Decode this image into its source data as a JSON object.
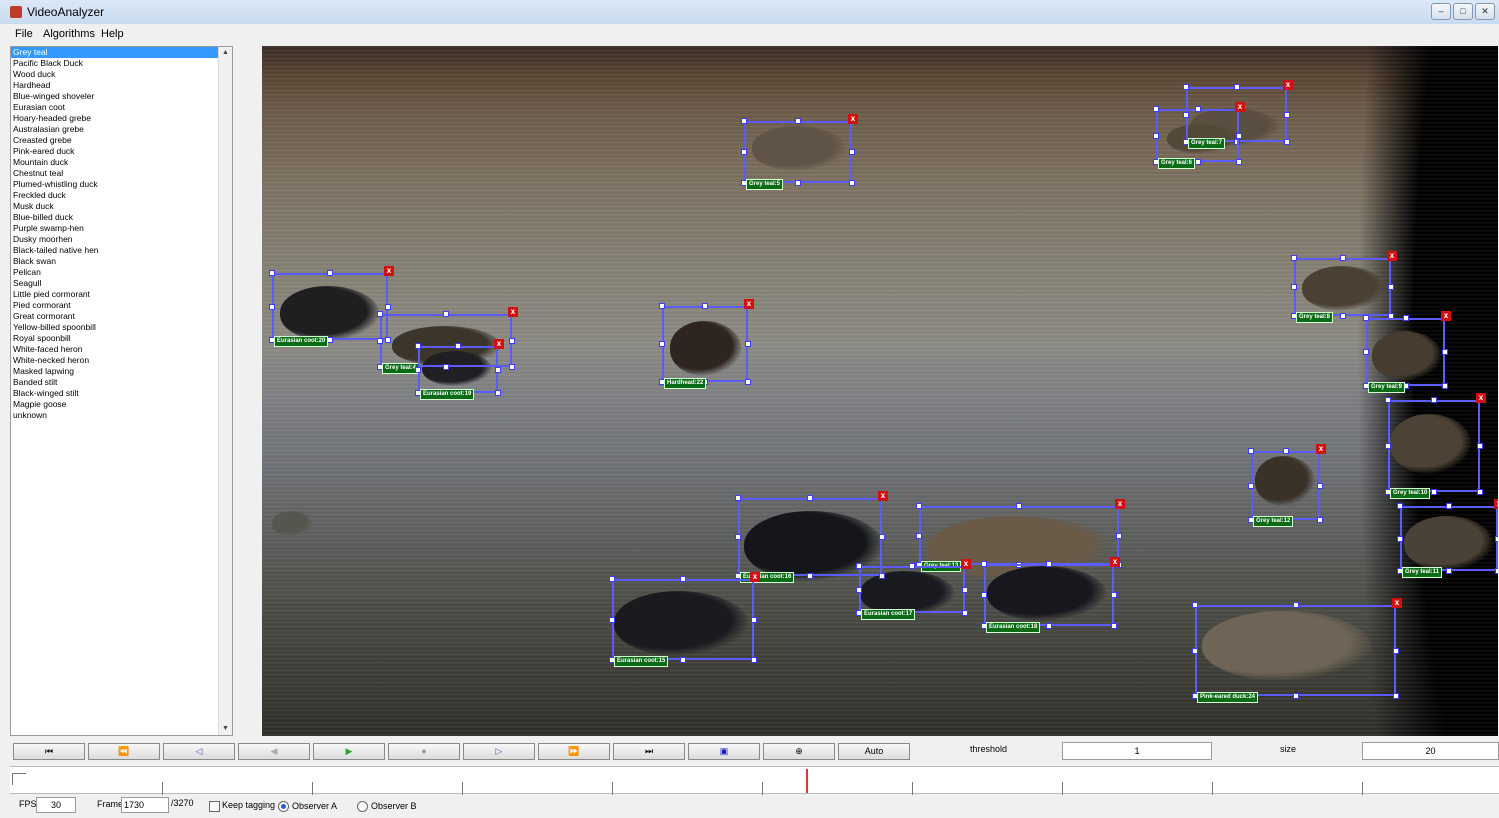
{
  "window": {
    "title": "VideoAnalyzer"
  },
  "menu": [
    "File",
    "Algorithms",
    "Help"
  ],
  "species_list": {
    "selected_index": 0,
    "items": [
      "Grey teal",
      "Pacific Black Duck",
      "Wood duck",
      "Hardhead",
      "Blue-winged shoveler",
      "Eurasian coot",
      "Hoary-headed grebe",
      "Australasian grebe",
      "Creasted grebe",
      "Pink-eared duck",
      "Mountain duck",
      "Chestnut teal",
      "Plumed-whistling duck",
      "Freckled duck",
      "Musk duck",
      "Blue-billed duck",
      "Purple swamp-hen",
      "Dusky moorhen",
      "Black-tailed native hen",
      "Black swan",
      "Pelican",
      "Seagull",
      "Little pied cormorant",
      "Pied cormorant",
      "Great cormorant",
      "Yellow-billed spoonbill",
      "Royal spoonbill",
      "White-faced heron",
      "White-necked heron",
      "Masked lapwing",
      "Banded stilt",
      "Black-winged stilt",
      "Magpie goose",
      "unknown"
    ]
  },
  "detections": [
    {
      "label": "Grey teal:5"
    },
    {
      "label": "Grey teal:7"
    },
    {
      "label": "Grey teal:6"
    },
    {
      "label": "Eurasian coot:20"
    },
    {
      "label": "Grey teal:4"
    },
    {
      "label": "Eurasian coot:19"
    },
    {
      "label": "Hardhead:22"
    },
    {
      "label": "Grey teal:8"
    },
    {
      "label": "Grey teal:9"
    },
    {
      "label": "Grey teal:10"
    },
    {
      "label": "Grey teal:12"
    },
    {
      "label": "Grey teal:11"
    },
    {
      "label": "Eurasian coot:16"
    },
    {
      "label": "Grey teal:13"
    },
    {
      "label": "Eurasian coot:17"
    },
    {
      "label": "Eurasian coot:18"
    },
    {
      "label": "Eurasian coot:15"
    },
    {
      "label": "Pink-eared duck:24"
    }
  ],
  "box_close_glyph": "x",
  "controls": {
    "buttons": [
      {
        "name": "first-frame",
        "glyph": "⏮"
      },
      {
        "name": "rewind",
        "glyph": "⏪"
      },
      {
        "name": "step-back",
        "glyph": "◁"
      },
      {
        "name": "play-reverse",
        "glyph": "◀"
      },
      {
        "name": "play",
        "glyph": "▶"
      },
      {
        "name": "stop",
        "glyph": "●"
      },
      {
        "name": "step-forward",
        "glyph": "▷"
      },
      {
        "name": "fast-forward",
        "glyph": "⏩"
      },
      {
        "name": "last-frame",
        "glyph": "⏭"
      },
      {
        "name": "select-region",
        "glyph": "▣"
      },
      {
        "name": "zoom",
        "glyph": "⊕"
      }
    ],
    "auto_label": "Auto",
    "threshold_label": "threshold",
    "threshold_value": "1",
    "size_label": "size",
    "size_value": "20"
  },
  "status": {
    "fps_label": "FPS",
    "fps_value": "30",
    "frame_label": "Frame",
    "frame_value": "1730",
    "frame_total": "/3270",
    "keep_tagging_label": "Keep tagging",
    "keep_tagging": false,
    "observer_a_label": "Observer A",
    "observer_b_label": "Observer B",
    "observer_selected": "A"
  },
  "colors": {
    "accent": "#3399ff",
    "box": "#5b5bff",
    "tag": "#0b6b16",
    "close": "#d31010",
    "cursor": "#e53333"
  }
}
